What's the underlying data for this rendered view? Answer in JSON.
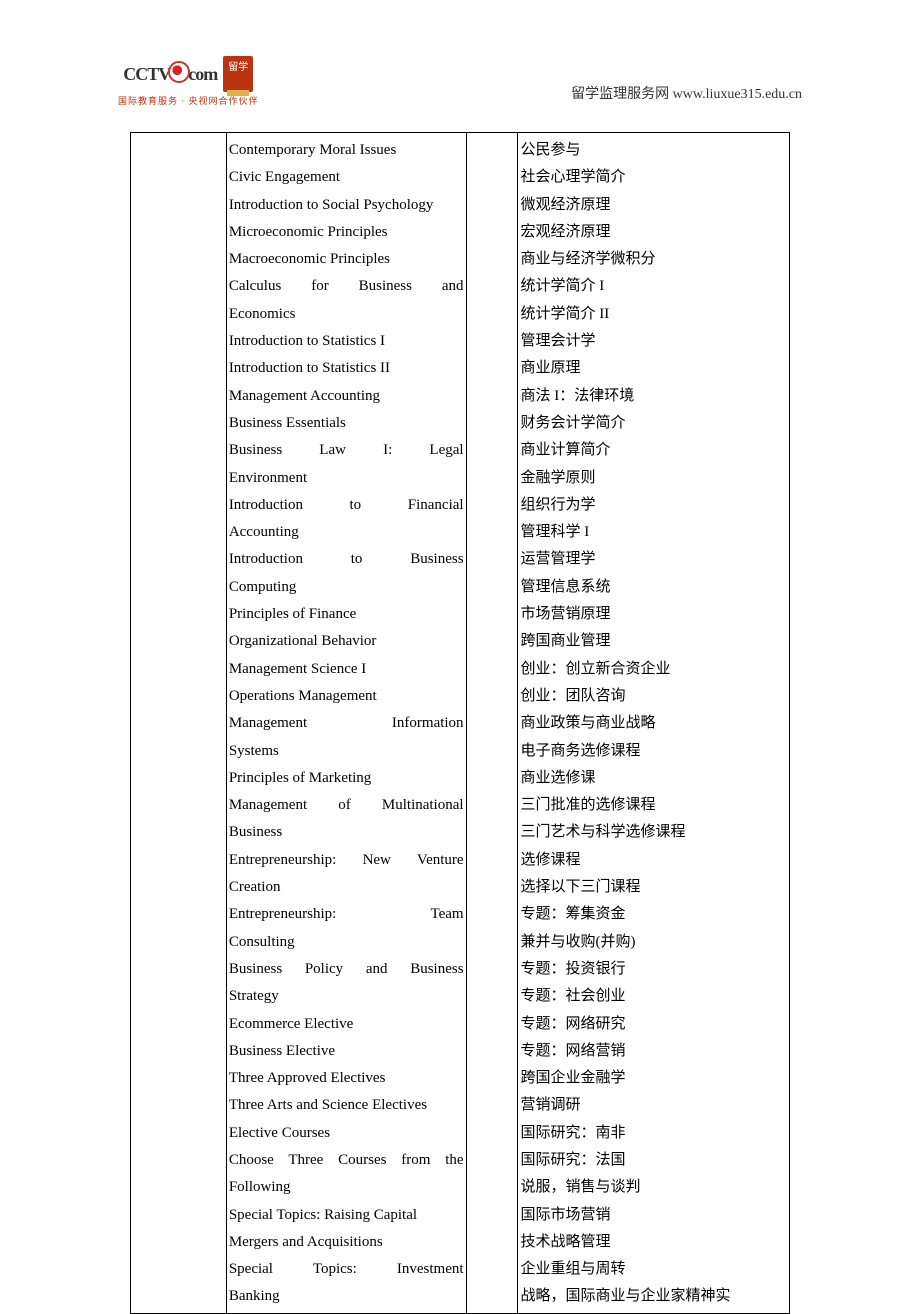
{
  "header": {
    "logo_text_1": "CCTV",
    "logo_text_2": "com",
    "badge_text": "留学",
    "tagline_left": "国际教育服务",
    "tagline_right": "央视网合作伙伴",
    "right_text": "留学监理服务网 www.liuxue315.edu.cn"
  },
  "english_lines": [
    {
      "t": "Contemporary Moral Issues",
      "j": false
    },
    {
      "t": "Civic Engagement",
      "j": false
    },
    {
      "t": "Introduction to Social Psychology",
      "j": false
    },
    {
      "t": "Microeconomic Principles",
      "j": false
    },
    {
      "t": "Macroeconomic Principles",
      "j": false
    },
    {
      "t": "Calculus for Business and",
      "j": true
    },
    {
      "t": "Economics",
      "j": false
    },
    {
      "t": "Introduction to Statistics I",
      "j": false
    },
    {
      "t": "Introduction to Statistics II",
      "j": false
    },
    {
      "t": "Management Accounting",
      "j": false
    },
    {
      "t": "Business Essentials",
      "j": false
    },
    {
      "t": "Business Law I: Legal",
      "j": true
    },
    {
      "t": "Environment",
      "j": false
    },
    {
      "t": "Introduction to Financial",
      "j": true
    },
    {
      "t": "Accounting",
      "j": false
    },
    {
      "t": "Introduction to Business",
      "j": true
    },
    {
      "t": "Computing",
      "j": false
    },
    {
      "t": "Principles of Finance",
      "j": false
    },
    {
      "t": "Organizational Behavior",
      "j": false
    },
    {
      "t": "Management Science I",
      "j": false
    },
    {
      "t": "Operations Management",
      "j": false
    },
    {
      "t": "Management Information",
      "j": true
    },
    {
      "t": "Systems",
      "j": false
    },
    {
      "t": "Principles of Marketing",
      "j": false
    },
    {
      "t": "Management of Multinational",
      "j": true
    },
    {
      "t": "Business",
      "j": false
    },
    {
      "t": "Entrepreneurship: New Venture",
      "j": true
    },
    {
      "t": "Creation",
      "j": false
    },
    {
      "t": "Entrepreneurship: Team",
      "j": true
    },
    {
      "t": "Consulting",
      "j": false
    },
    {
      "t": "Business Policy and Business",
      "j": true
    },
    {
      "t": "Strategy",
      "j": false
    },
    {
      "t": "Ecommerce Elective",
      "j": false
    },
    {
      "t": "Business Elective",
      "j": false
    },
    {
      "t": "Three Approved Electives",
      "j": false
    },
    {
      "t": "Three Arts and Science Electives",
      "j": false
    },
    {
      "t": "Elective Courses",
      "j": false
    },
    {
      "t": "Choose Three Courses from the",
      "j": true
    },
    {
      "t": "Following",
      "j": false
    },
    {
      "t": "Special Topics: Raising Capital",
      "j": false
    },
    {
      "t": "Mergers and Acquisitions",
      "j": false
    },
    {
      "t": "Special Topics: Investment",
      "j": true
    },
    {
      "t": "Banking",
      "j": false
    }
  ],
  "chinese_lines": [
    "公民参与",
    "社会心理学简介",
    "微观经济原理",
    "宏观经济原理",
    "商业与经济学微积分",
    "统计学简介 I",
    "统计学简介 II",
    "管理会计学",
    "商业原理",
    "商法 I：法律环境",
    "财务会计学简介",
    "商业计算简介",
    "金融学原则",
    "组织行为学",
    "管理科学 I",
    "运营管理学",
    "管理信息系统",
    "市场营销原理",
    "跨国商业管理",
    "创业：创立新合资企业",
    "创业：团队咨询",
    "商业政策与商业战略",
    "电子商务选修课程",
    "商业选修课",
    "三门批准的选修课程",
    "三门艺术与科学选修课程",
    "选修课程",
    "选择以下三门课程",
    "专题：筹集资金",
    "兼并与收购(并购)",
    "专题：投资银行",
    "专题：社会创业",
    "专题：网络研究",
    "专题：网络营销",
    "跨国企业金融学",
    "营销调研",
    "国际研究：南非",
    "国际研究：法国",
    "说服，销售与谈判",
    "国际市场营销",
    "技术战略管理",
    "企业重组与周转",
    "战略，国际商业与企业家精神实"
  ]
}
